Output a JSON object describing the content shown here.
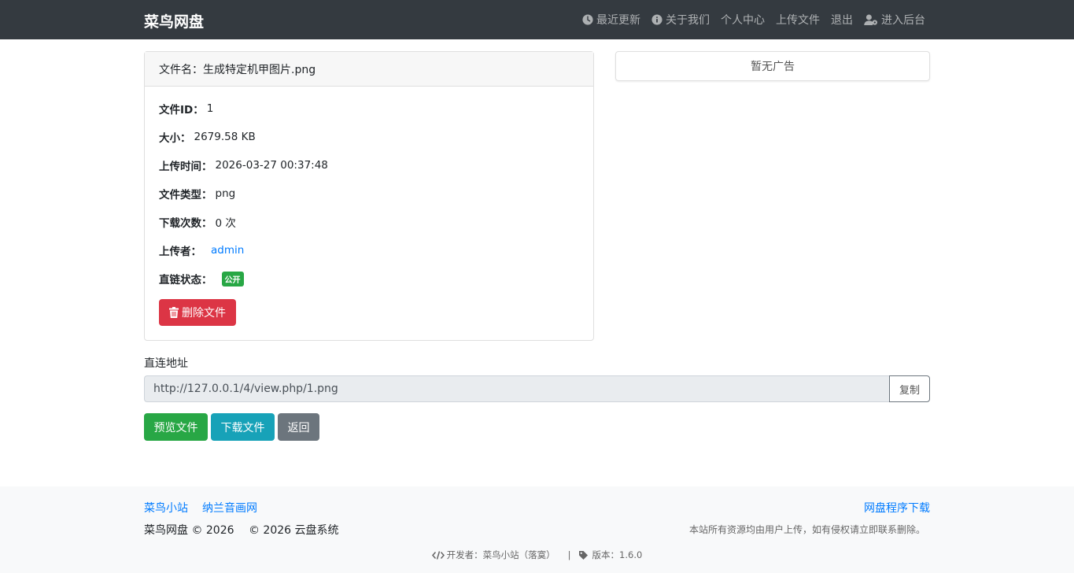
{
  "navbar": {
    "brand": "菜鸟网盘",
    "items": [
      {
        "label": "最近更新",
        "icon": "clock-icon"
      },
      {
        "label": "关于我们",
        "icon": "info-icon"
      },
      {
        "label": "个人中心"
      },
      {
        "label": "上传文件"
      },
      {
        "label": "退出"
      },
      {
        "label": "进入后台",
        "icon": "user-cog-icon"
      }
    ]
  },
  "file": {
    "name_label": "文件名：",
    "name": "生成特定机甲图片.png",
    "id_label": "文件ID：",
    "id": "1",
    "size_label": "大小：",
    "size": "2679.58 KB",
    "upload_time_label": "上传时间：",
    "upload_time": "2026-03-27 00:37:48",
    "type_label": "文件类型：",
    "type": "png",
    "downloads_label": "下载次数：",
    "downloads": "0 次",
    "uploader_label": "上传者：",
    "uploader": "admin",
    "link_status_label": "直链状态：",
    "link_status": "公开",
    "delete_button": "删除文件"
  },
  "ad": {
    "text": "暂无广告"
  },
  "direct_link": {
    "label": "直连地址",
    "url": "http://127.0.0.1/4/view.php/1.png",
    "copy_button": "复制"
  },
  "actions": {
    "preview": "预览文件",
    "download": "下载文件",
    "back": "返回"
  },
  "colors": {
    "navbar": "#343a40",
    "success": "#28a745",
    "info": "#17a2b8",
    "danger": "#dc3545",
    "secondary": "#6c757d",
    "link": "#007bff"
  },
  "footer": {
    "links": [
      "菜鸟小站",
      "纳兰音画网"
    ],
    "right_link": "网盘程序下载",
    "copyright_1": "菜鸟网盘 © 2026",
    "copyright_2": "© 2026 云盘系统",
    "notice": "本站所有资源均由用户上传，如有侵权请立即联系删除。",
    "developer": "开发者：菜鸟小站（落寞）",
    "separator": "|",
    "version": "版本：1.6.0"
  }
}
